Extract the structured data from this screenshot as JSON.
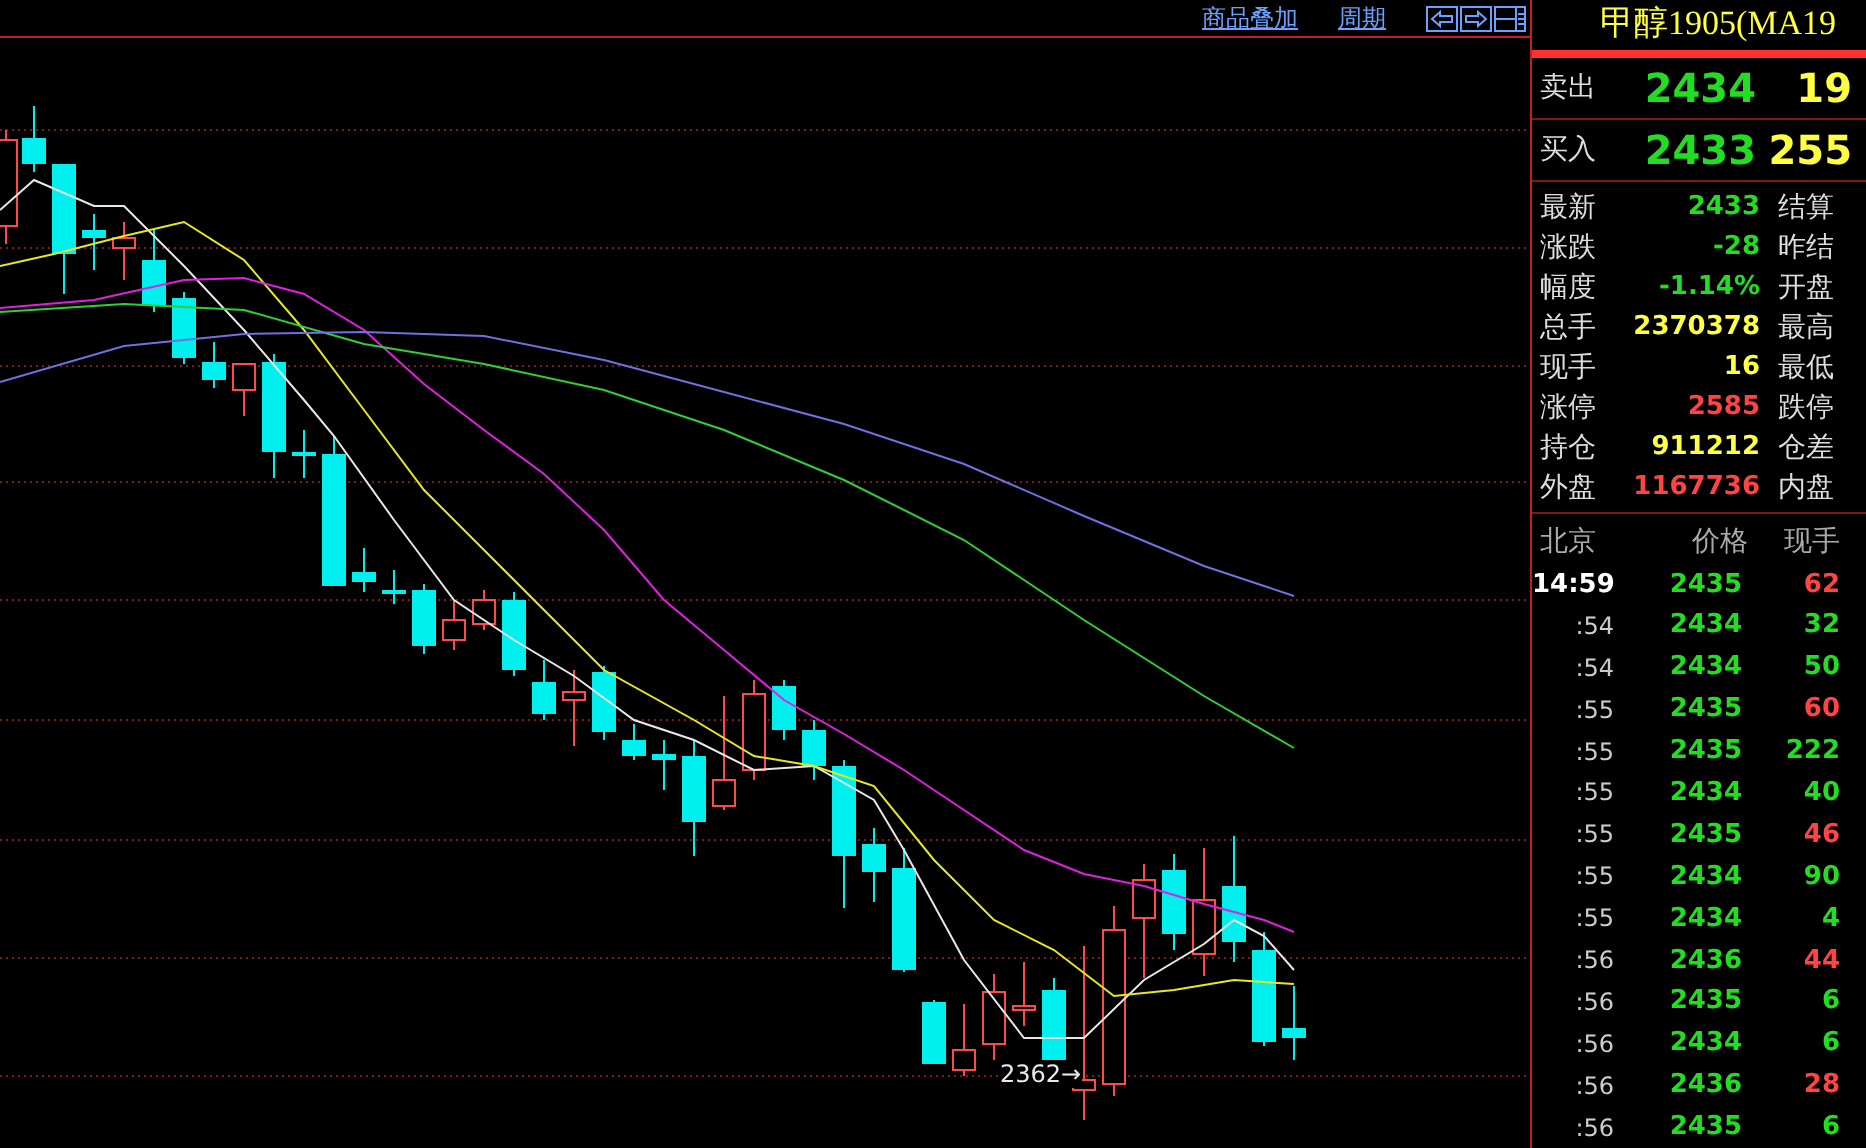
{
  "toolbar": {
    "links": [
      "商品叠加",
      "周期"
    ]
  },
  "chart": {
    "low_label": "2362→"
  },
  "quote": {
    "title": "甲醇1905(MA19",
    "orders": [
      {
        "label": "卖出",
        "price": "2434",
        "volume": "19"
      },
      {
        "label": "买入",
        "price": "2433",
        "volume": "255"
      }
    ],
    "stats": [
      {
        "label": "最新",
        "value": "2433",
        "color": "#22dd22",
        "label_right": "结算"
      },
      {
        "label": "涨跌",
        "value": "-28",
        "color": "#22dd22",
        "label_right": "昨结"
      },
      {
        "label": "幅度",
        "value": "-1.14%",
        "color": "#22dd22",
        "label_right": "开盘"
      },
      {
        "label": "总手",
        "value": "2370378",
        "color": "#ffff44",
        "label_right": "最高"
      },
      {
        "label": "现手",
        "value": "16",
        "color": "#ffff44",
        "label_right": "最低"
      },
      {
        "label": "涨停",
        "value": "2585",
        "color": "#ff4444",
        "label_right": "跌停"
      },
      {
        "label": "持仓",
        "value": "911212",
        "color": "#ffff44",
        "label_right": "仓差"
      },
      {
        "label": "外盘",
        "value": "1167736",
        "color": "#ff4444",
        "label_right": "内盘"
      }
    ]
  },
  "ticks": {
    "columns": [
      "北京",
      "价格",
      "现手"
    ],
    "rows": [
      {
        "kind": "full",
        "time": "14:59",
        "price": "2435",
        "volume": "62",
        "color": "#ff4444"
      },
      {
        "kind": "short",
        "time": ":54",
        "price": "2434",
        "volume": "32",
        "color": "#22dd22"
      },
      {
        "kind": "short",
        "time": ":54",
        "price": "2434",
        "volume": "50",
        "color": "#22dd22"
      },
      {
        "kind": "short",
        "time": ":55",
        "price": "2435",
        "volume": "60",
        "color": "#ff4444"
      },
      {
        "kind": "short",
        "time": ":55",
        "price": "2435",
        "volume": "222",
        "color": "#22dd22"
      },
      {
        "kind": "short",
        "time": ":55",
        "price": "2434",
        "volume": "40",
        "color": "#22dd22"
      },
      {
        "kind": "short",
        "time": ":55",
        "price": "2435",
        "volume": "46",
        "color": "#ff4444"
      },
      {
        "kind": "short",
        "time": ":55",
        "price": "2434",
        "volume": "90",
        "color": "#22dd22"
      },
      {
        "kind": "short",
        "time": ":55",
        "price": "2434",
        "volume": "4",
        "color": "#22dd22"
      },
      {
        "kind": "short",
        "time": ":56",
        "price": "2436",
        "volume": "44",
        "color": "#ff4444"
      },
      {
        "kind": "short",
        "time": ":56",
        "price": "2435",
        "volume": "6",
        "color": "#22dd22"
      },
      {
        "kind": "short",
        "time": ":56",
        "price": "2434",
        "volume": "6",
        "color": "#22dd22"
      },
      {
        "kind": "short",
        "time": ":56",
        "price": "2436",
        "volume": "28",
        "color": "#ff4444"
      },
      {
        "kind": "short",
        "time": ":56",
        "price": "2435",
        "volume": "6",
        "color": "#22dd22"
      }
    ]
  }
}
